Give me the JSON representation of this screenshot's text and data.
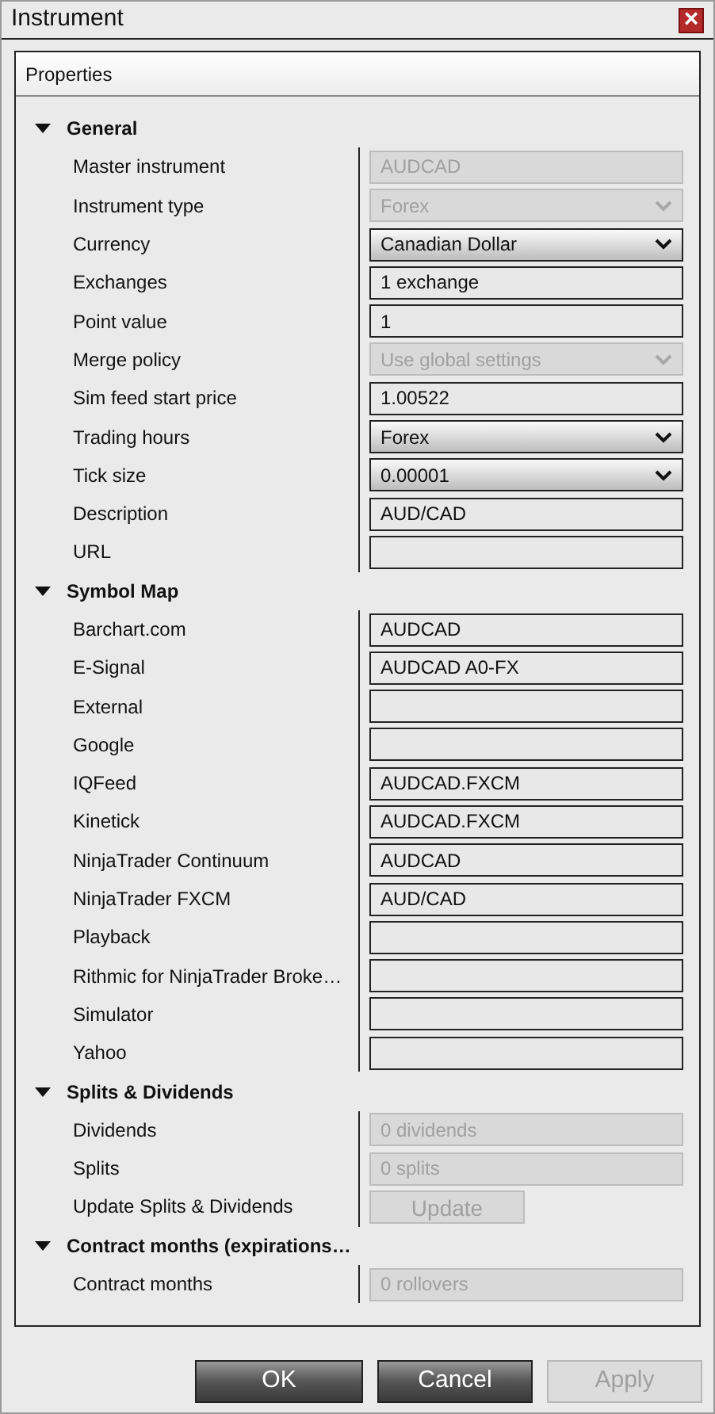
{
  "window": {
    "title": "Instrument",
    "close_glyph": "×"
  },
  "panel": {
    "title": "Properties"
  },
  "sections": [
    {
      "title": "General",
      "expanded": true,
      "rows": [
        {
          "label": "Master instrument",
          "kind": "text",
          "value": "AUDCAD",
          "disabled": true
        },
        {
          "label": "Instrument type",
          "kind": "select",
          "value": "Forex",
          "disabled": true
        },
        {
          "label": "Currency",
          "kind": "select",
          "value": "Canadian Dollar",
          "disabled": false
        },
        {
          "label": "Exchanges",
          "kind": "text",
          "value": "1 exchange",
          "disabled": false
        },
        {
          "label": "Point value",
          "kind": "text",
          "value": "1",
          "disabled": false
        },
        {
          "label": "Merge policy",
          "kind": "select",
          "value": "Use global settings",
          "disabled": true
        },
        {
          "label": "Sim feed start price",
          "kind": "text",
          "value": "1.00522",
          "disabled": false
        },
        {
          "label": "Trading hours",
          "kind": "select",
          "value": "Forex",
          "disabled": false
        },
        {
          "label": "Tick size",
          "kind": "select",
          "value": "0.00001",
          "disabled": false
        },
        {
          "label": "Description",
          "kind": "text",
          "value": "AUD/CAD",
          "disabled": false
        },
        {
          "label": "URL",
          "kind": "text",
          "disabled": false
        }
      ]
    },
    {
      "title": "Symbol Map",
      "expanded": true,
      "rows": [
        {
          "label": "Barchart.com",
          "kind": "text",
          "value": "AUDCAD",
          "disabled": false
        },
        {
          "label": "E-Signal",
          "kind": "text",
          "value": "AUDCAD A0-FX",
          "disabled": false
        },
        {
          "label": "External",
          "kind": "text",
          "disabled": false
        },
        {
          "label": "Google",
          "kind": "text",
          "disabled": false
        },
        {
          "label": "IQFeed",
          "kind": "text",
          "value": "AUDCAD.FXCM",
          "disabled": false
        },
        {
          "label": "Kinetick",
          "kind": "text",
          "value": "AUDCAD.FXCM",
          "disabled": false
        },
        {
          "label": "NinjaTrader Continuum",
          "kind": "text",
          "value": "AUDCAD",
          "disabled": false
        },
        {
          "label": "NinjaTrader FXCM",
          "kind": "text",
          "value": "AUD/CAD",
          "disabled": false
        },
        {
          "label": "Playback",
          "kind": "text",
          "disabled": false
        },
        {
          "label": "Rithmic for NinjaTrader Broke…",
          "kind": "text",
          "disabled": false
        },
        {
          "label": "Simulator",
          "kind": "text",
          "disabled": false
        },
        {
          "label": "Yahoo",
          "kind": "text",
          "disabled": false
        }
      ]
    },
    {
      "title": "Splits & Dividends",
      "expanded": true,
      "rows": [
        {
          "label": "Dividends",
          "kind": "text",
          "value": "0 dividends",
          "disabled": true
        },
        {
          "label": "Splits",
          "kind": "text",
          "value": "0 splits",
          "disabled": true
        },
        {
          "label": "Update Splits & Dividends",
          "kind": "button",
          "value": "Update",
          "disabled": true
        }
      ]
    },
    {
      "title": "Contract months (expirations…",
      "expanded": true,
      "rows": [
        {
          "label": "Contract months",
          "kind": "text",
          "value": "0 rollovers",
          "disabled": true
        }
      ]
    }
  ],
  "buttons": [
    {
      "label": "OK",
      "disabled": false
    },
    {
      "label": "Cancel",
      "disabled": false
    },
    {
      "label": "Apply",
      "disabled": true
    }
  ]
}
